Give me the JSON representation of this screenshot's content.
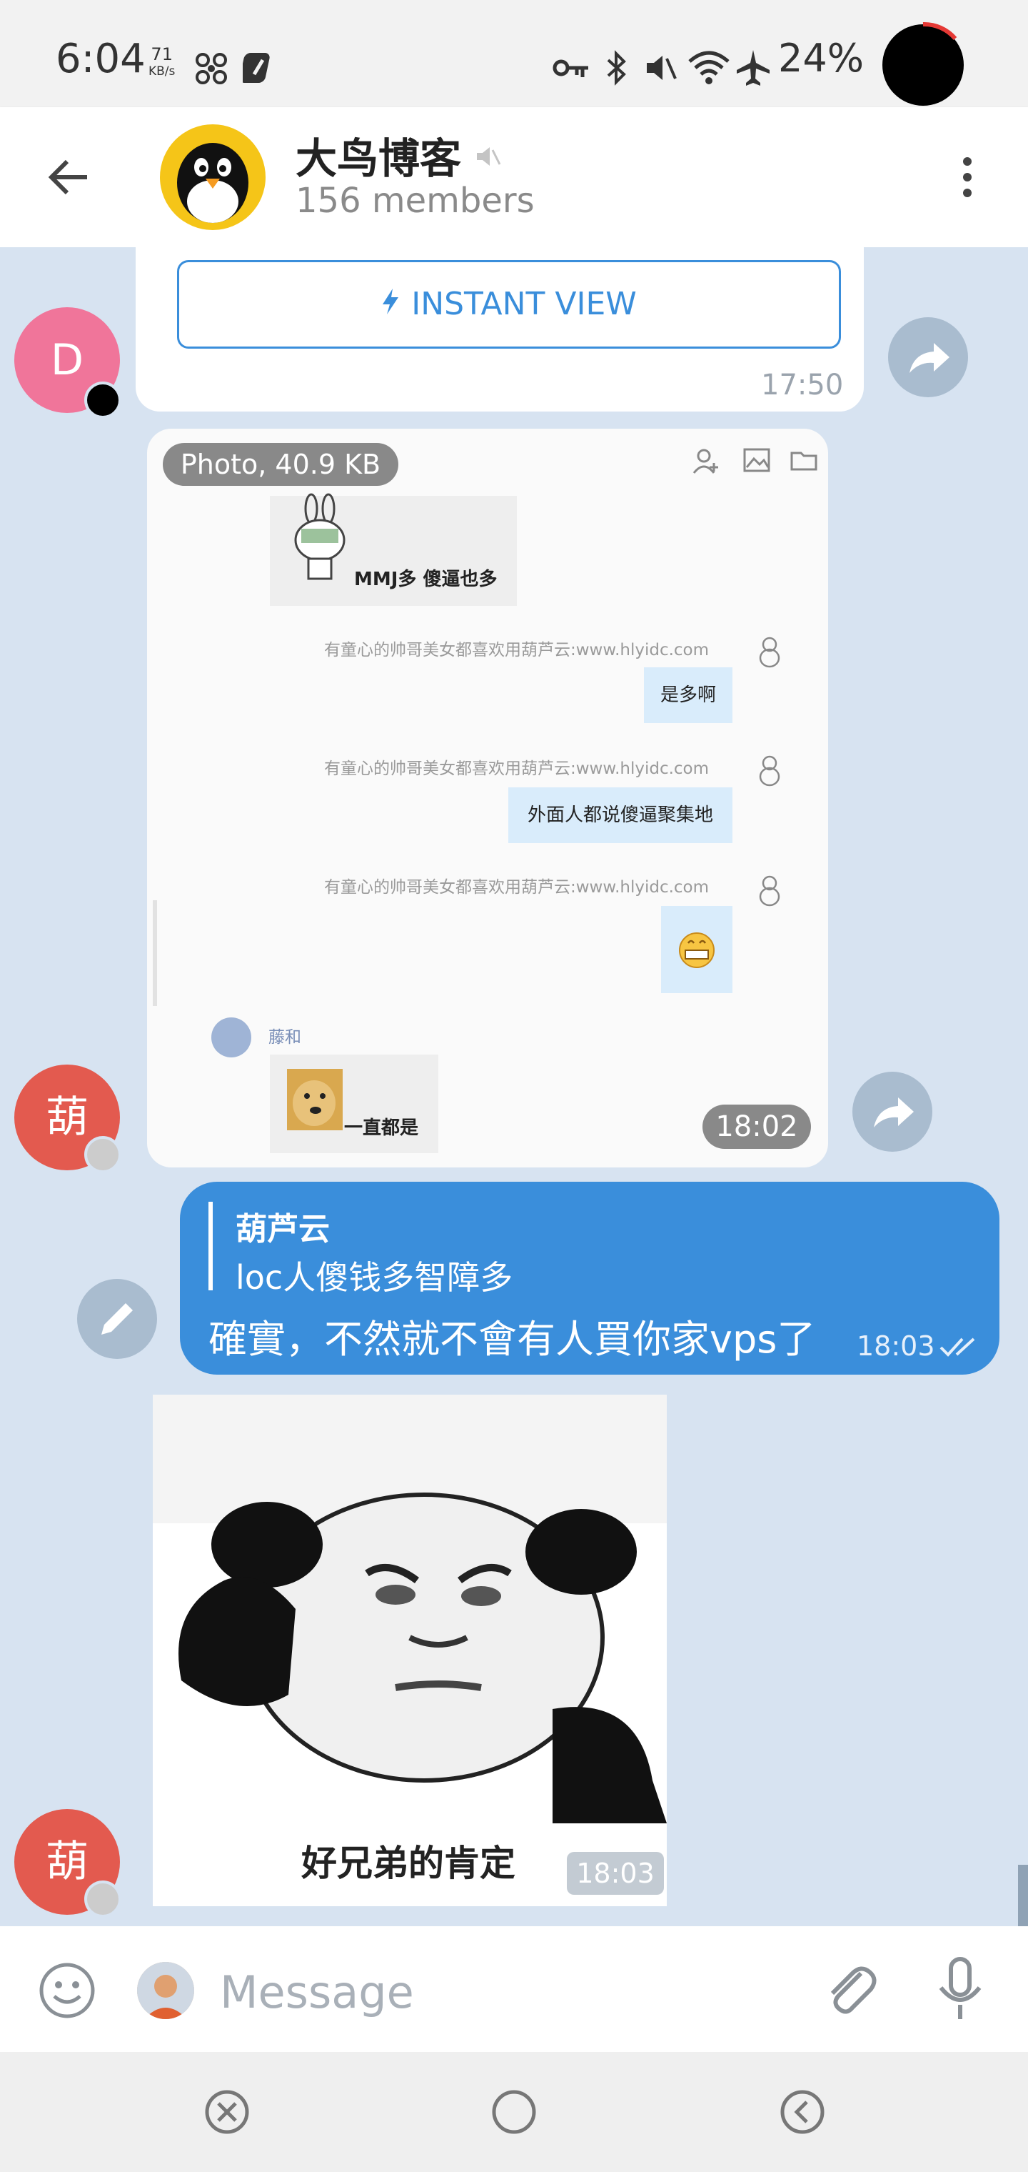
{
  "status_bar": {
    "time": "6:04",
    "speed_value": "71",
    "speed_unit": "KB/s",
    "battery": "24%"
  },
  "header": {
    "title": "大鸟博客",
    "subtitle": "156 members"
  },
  "messages": {
    "link_card": {
      "button_label": "INSTANT VIEW",
      "time": "17:50",
      "avatar_letter": "D"
    },
    "photo": {
      "badge": "Photo, 40.9 KB",
      "time": "18:02",
      "avatar_letter": "葫",
      "screenshot": {
        "sticker_caption": "MMJ多 傻逼也多",
        "sender_1": "有童心的帅哥美女都喜欢用葫芦云:www.hlyidc.com",
        "reply_1": "是多啊",
        "sender_2": "有童心的帅哥美女都喜欢用葫芦云:www.hlyidc.com",
        "reply_2": "外面人都说傻逼聚集地",
        "sender_3": "有童心的帅哥美女都喜欢用葫芦云:www.hlyidc.com",
        "other_name": "藤和",
        "other_text": "一直都是"
      }
    },
    "outgoing": {
      "quote_name": "葫芦云",
      "quote_text": "loc人傻钱多智障多",
      "text": "確實，不然就不會有人買你家vps了",
      "time": "18:03"
    },
    "sticker": {
      "caption": "好兄弟的肯定",
      "time": "18:03",
      "avatar_letter": "葫"
    }
  },
  "input": {
    "placeholder": "Message"
  },
  "colors": {
    "accent": "#3a8edb",
    "chat_bg": "#d7e3f1",
    "avatar_red": "#e35a4f",
    "avatar_pink": "#f0759a"
  }
}
